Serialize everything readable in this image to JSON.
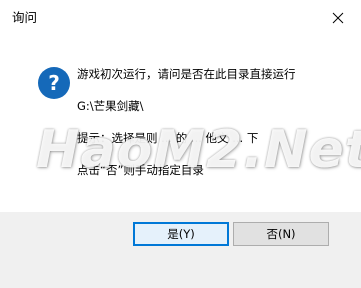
{
  "dialog": {
    "title": "询问",
    "close_icon": "close-icon"
  },
  "message": {
    "icon": "question-icon",
    "icon_glyph": "?",
    "icon_color": "#1569b9",
    "line1": "游戏初次运行，请问是否在此目录直接运行",
    "line2": "G:\\芒果剑藏\\",
    "line3": "提示：选择是则 ... 的 ... 他文 ... 下",
    "line4": "点击“否”则手动指定目录"
  },
  "buttons": {
    "yes_label": "是(Y)",
    "no_label": "否(N)"
  },
  "watermark": {
    "text": "HaoM2.Net"
  },
  "colors": {
    "accent": "#0078d7",
    "footer_bg": "#f0f0f0"
  }
}
